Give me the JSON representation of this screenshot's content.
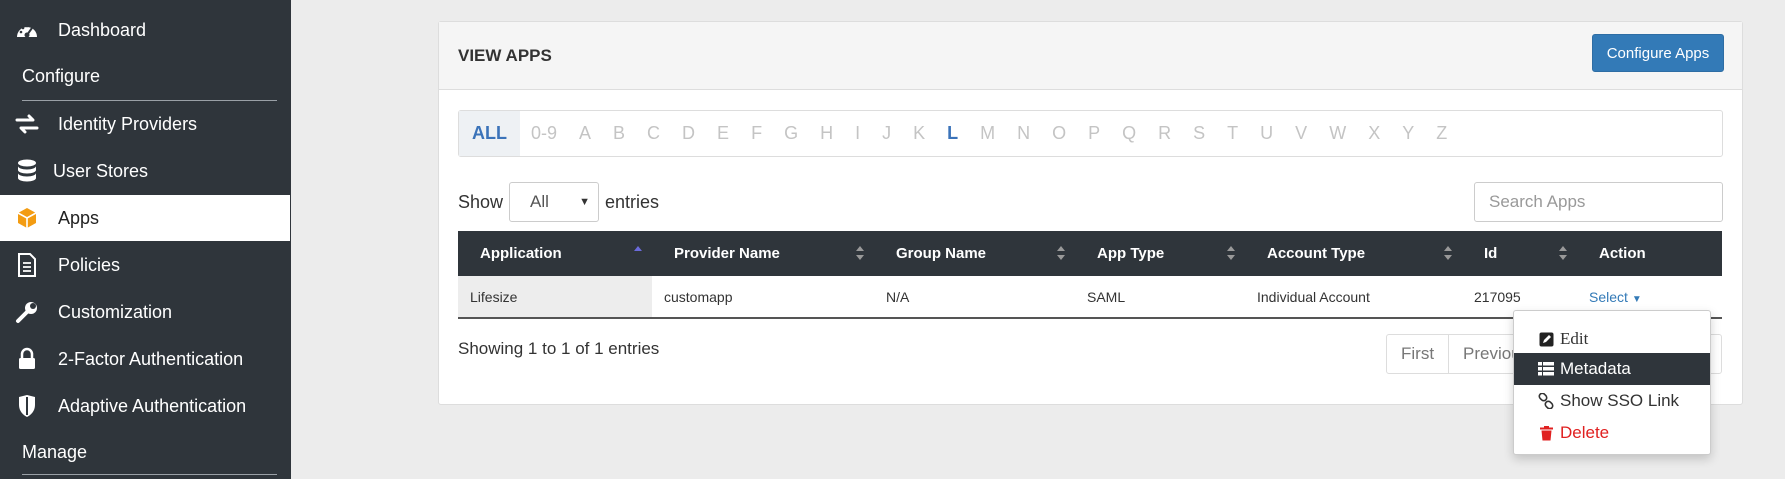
{
  "sidebar": {
    "items": [
      {
        "label": "Dashboard",
        "icon": "dashboard-icon"
      },
      {
        "label": "Identity Providers",
        "icon": "exchange-icon"
      },
      {
        "label": "User Stores",
        "icon": "database-icon"
      },
      {
        "label": "Apps",
        "icon": "cube-icon"
      },
      {
        "label": "Policies",
        "icon": "document-icon"
      },
      {
        "label": "Customization",
        "icon": "wrench-icon"
      },
      {
        "label": "2-Factor Authentication",
        "icon": "lock-icon"
      },
      {
        "label": "Adaptive Authentication",
        "icon": "shield-icon"
      }
    ],
    "sections": {
      "configure": "Configure",
      "manage": "Manage"
    },
    "accent_color": "#f39c12"
  },
  "panel": {
    "title": "VIEW APPS",
    "configure_button": "Configure Apps"
  },
  "alpha_filter": [
    "ALL",
    "0-9",
    "A",
    "B",
    "C",
    "D",
    "E",
    "F",
    "G",
    "H",
    "I",
    "J",
    "K",
    "L",
    "M",
    "N",
    "O",
    "P",
    "Q",
    "R",
    "S",
    "T",
    "U",
    "V",
    "W",
    "X",
    "Y",
    "Z"
  ],
  "entries": {
    "show": "Show",
    "selected": "All",
    "suffix": "entries"
  },
  "search": {
    "placeholder": "Search Apps"
  },
  "table": {
    "headers": [
      "Application",
      "Provider Name",
      "Group Name",
      "App Type",
      "Account Type",
      "Id",
      "Action"
    ],
    "rows": [
      [
        "Lifesize",
        "customapp",
        "N/A",
        "SAML",
        "Individual Account",
        "217095",
        "Select"
      ]
    ]
  },
  "footer": {
    "showing": "Showing 1 to 1 of 1 entries",
    "pager": [
      "First",
      "Previous"
    ]
  },
  "action_menu": {
    "items": [
      "Edit",
      "Metadata",
      "Show SSO Link",
      "Delete"
    ]
  }
}
